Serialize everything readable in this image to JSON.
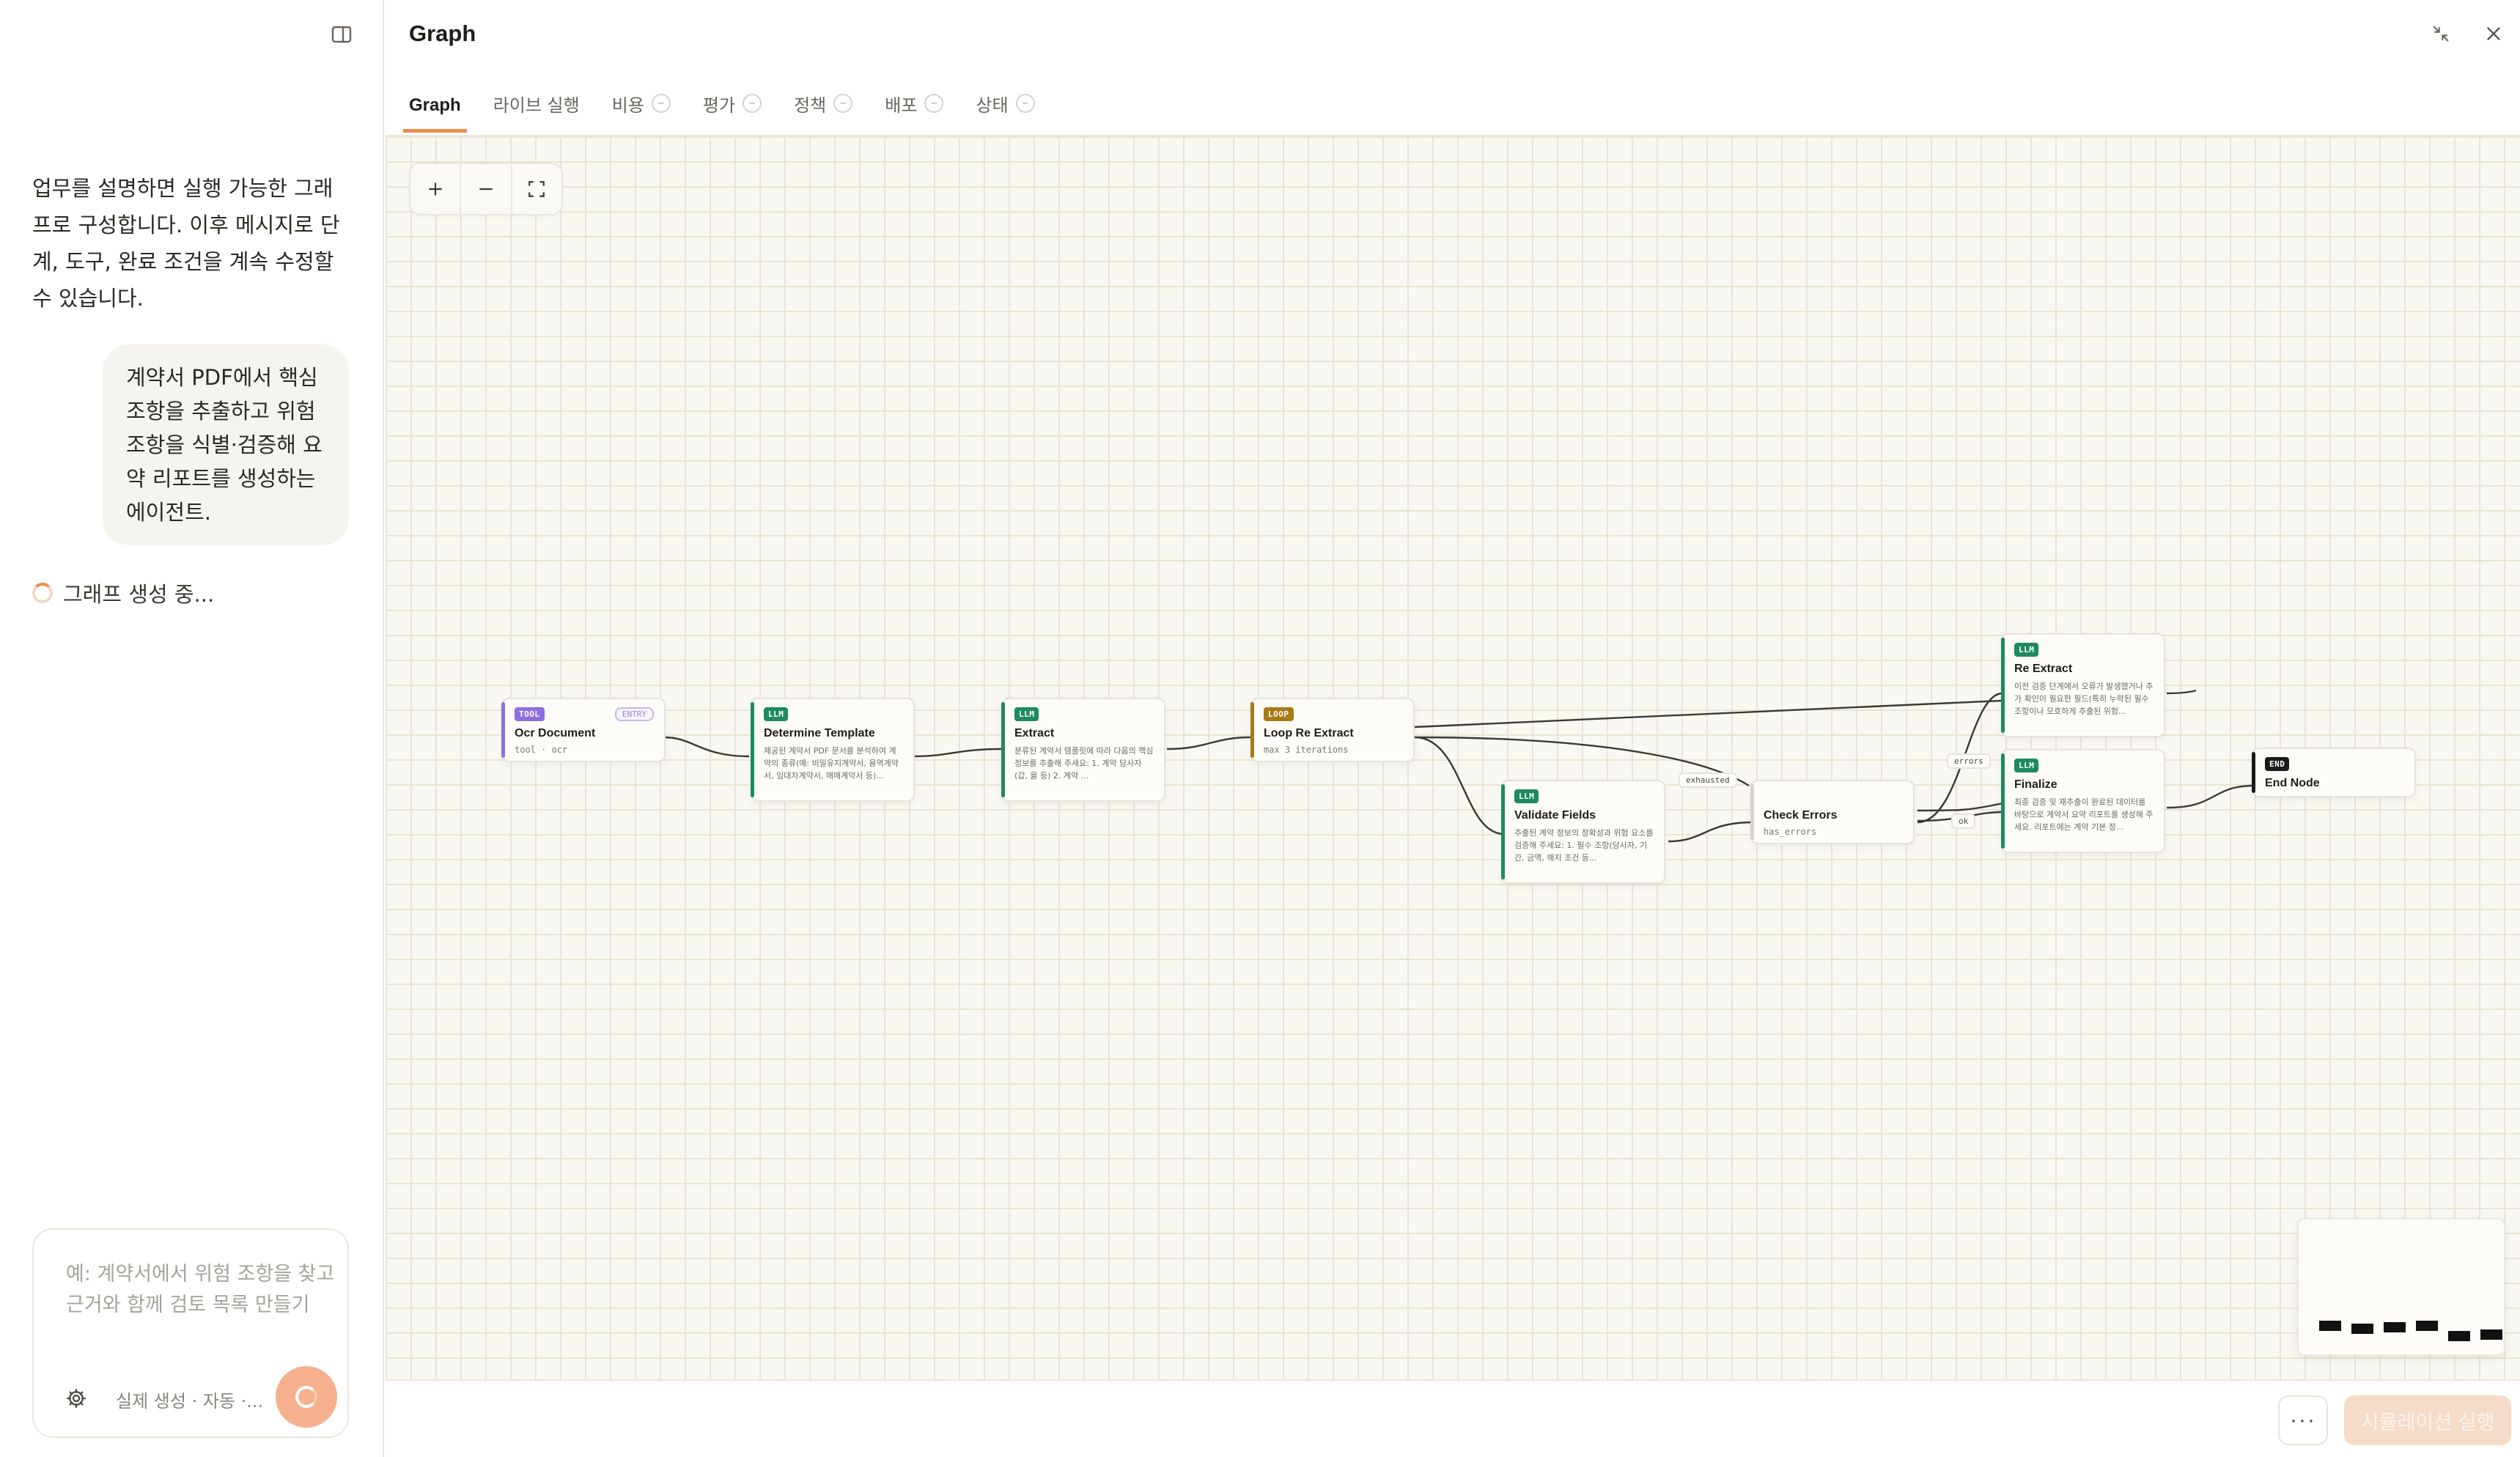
{
  "chat": {
    "intro": "업무를 설명하면 실행 가능한 그래프로 구성합니다. 이후 메시지로 단계, 도구, 완료 조건을 계속 수정할 수 있습니다.",
    "user_message": "계약서 PDF에서 핵심 조항을 추출하고 위험 조항을 식별·검증해 요약 리포트를 생성하는 에이전트.",
    "status": "그래프 생성 중...",
    "composer_placeholder": "예: 계약서에서 위험 조항을 찾고 근거와 함께 검토 목록 만들기",
    "composer_mode": "실제 생성 · 자동 ·..."
  },
  "panel": {
    "title": "Graph",
    "tabs": [
      {
        "label": "Graph"
      },
      {
        "label": "라이브 실행"
      },
      {
        "label": "비용",
        "dash": "–"
      },
      {
        "label": "평가",
        "dash": "–"
      },
      {
        "label": "정책",
        "dash": "–"
      },
      {
        "label": "배포",
        "dash": "–"
      },
      {
        "label": "상태",
        "dash": "–"
      }
    ]
  },
  "graph": {
    "nodes": [
      {
        "id": "ocr",
        "badge": "TOOL",
        "entry": "ENTRY",
        "title": "Ocr Document",
        "sub": "tool · ocr",
        "desc": "",
        "accent": "#8f6ee0"
      },
      {
        "id": "template",
        "badge": "LLM",
        "title": "Determine Template",
        "sub": "",
        "desc": "제공된 계약서 PDF 문서를 분석하여 계약의 종류(예: 비밀유지계약서, 용역계약서, 임대차계약서, 매매계약서 등)...",
        "accent": "#1d8a61"
      },
      {
        "id": "extract",
        "badge": "LLM",
        "title": "Extract",
        "sub": "",
        "desc": "분류된 계약서 템플릿에 따라 다음의 핵심 정보를 추출해 주세요: 1. 계약 당사자 (갑, 을 등) 2. 계약 ...",
        "accent": "#1d8a61"
      },
      {
        "id": "loop",
        "badge": "LOOP",
        "title": "Loop Re Extract",
        "sub": "max 3 iterations",
        "desc": "",
        "accent": "#a77a14"
      },
      {
        "id": "validate",
        "badge": "LLM",
        "title": "Validate Fields",
        "sub": "",
        "desc": "추출된 계약 정보의 정확성과 위험 요소를 검증해 주세요: 1. 필수 조항(당사자, 기간, 금액, 해지 조건 등...",
        "accent": "#1d8a61"
      },
      {
        "id": "check",
        "badge": "",
        "title": "Check Errors",
        "sub": "has_errors",
        "desc": "",
        "accent": "#d9d4c8"
      },
      {
        "id": "reextract",
        "badge": "LLM",
        "title": "Re Extract",
        "sub": "",
        "desc": "이전 검증 단계에서 오류가 발생했거나 추가 확인이 필요한 필드(특히 누락된 필수 조항이나 모호하게 추출된 위험...",
        "accent": "#1d8a61"
      },
      {
        "id": "finalize",
        "badge": "LLM",
        "title": "Finalize",
        "sub": "",
        "desc": "최종 검증 및 재추출이 완료된 데이터를 바탕으로 계약서 요약 리포트를 생성해 주세요. 리포트에는 계약 기본 정...",
        "accent": "#1d8a61"
      },
      {
        "id": "end",
        "badge": "END",
        "title": "End Node",
        "sub": "",
        "desc": "",
        "accent": "#1a1a1a"
      }
    ],
    "edge_labels": {
      "exhausted": "exhausted",
      "errors": "errors",
      "ok": "ok"
    }
  },
  "actions": {
    "more": "···",
    "run": "시뮬레이션 실행"
  },
  "colors": {
    "accent": "#ef8a4c",
    "llm": "#1d8a61",
    "tool": "#8f6ee0",
    "loop": "#a77a14"
  }
}
